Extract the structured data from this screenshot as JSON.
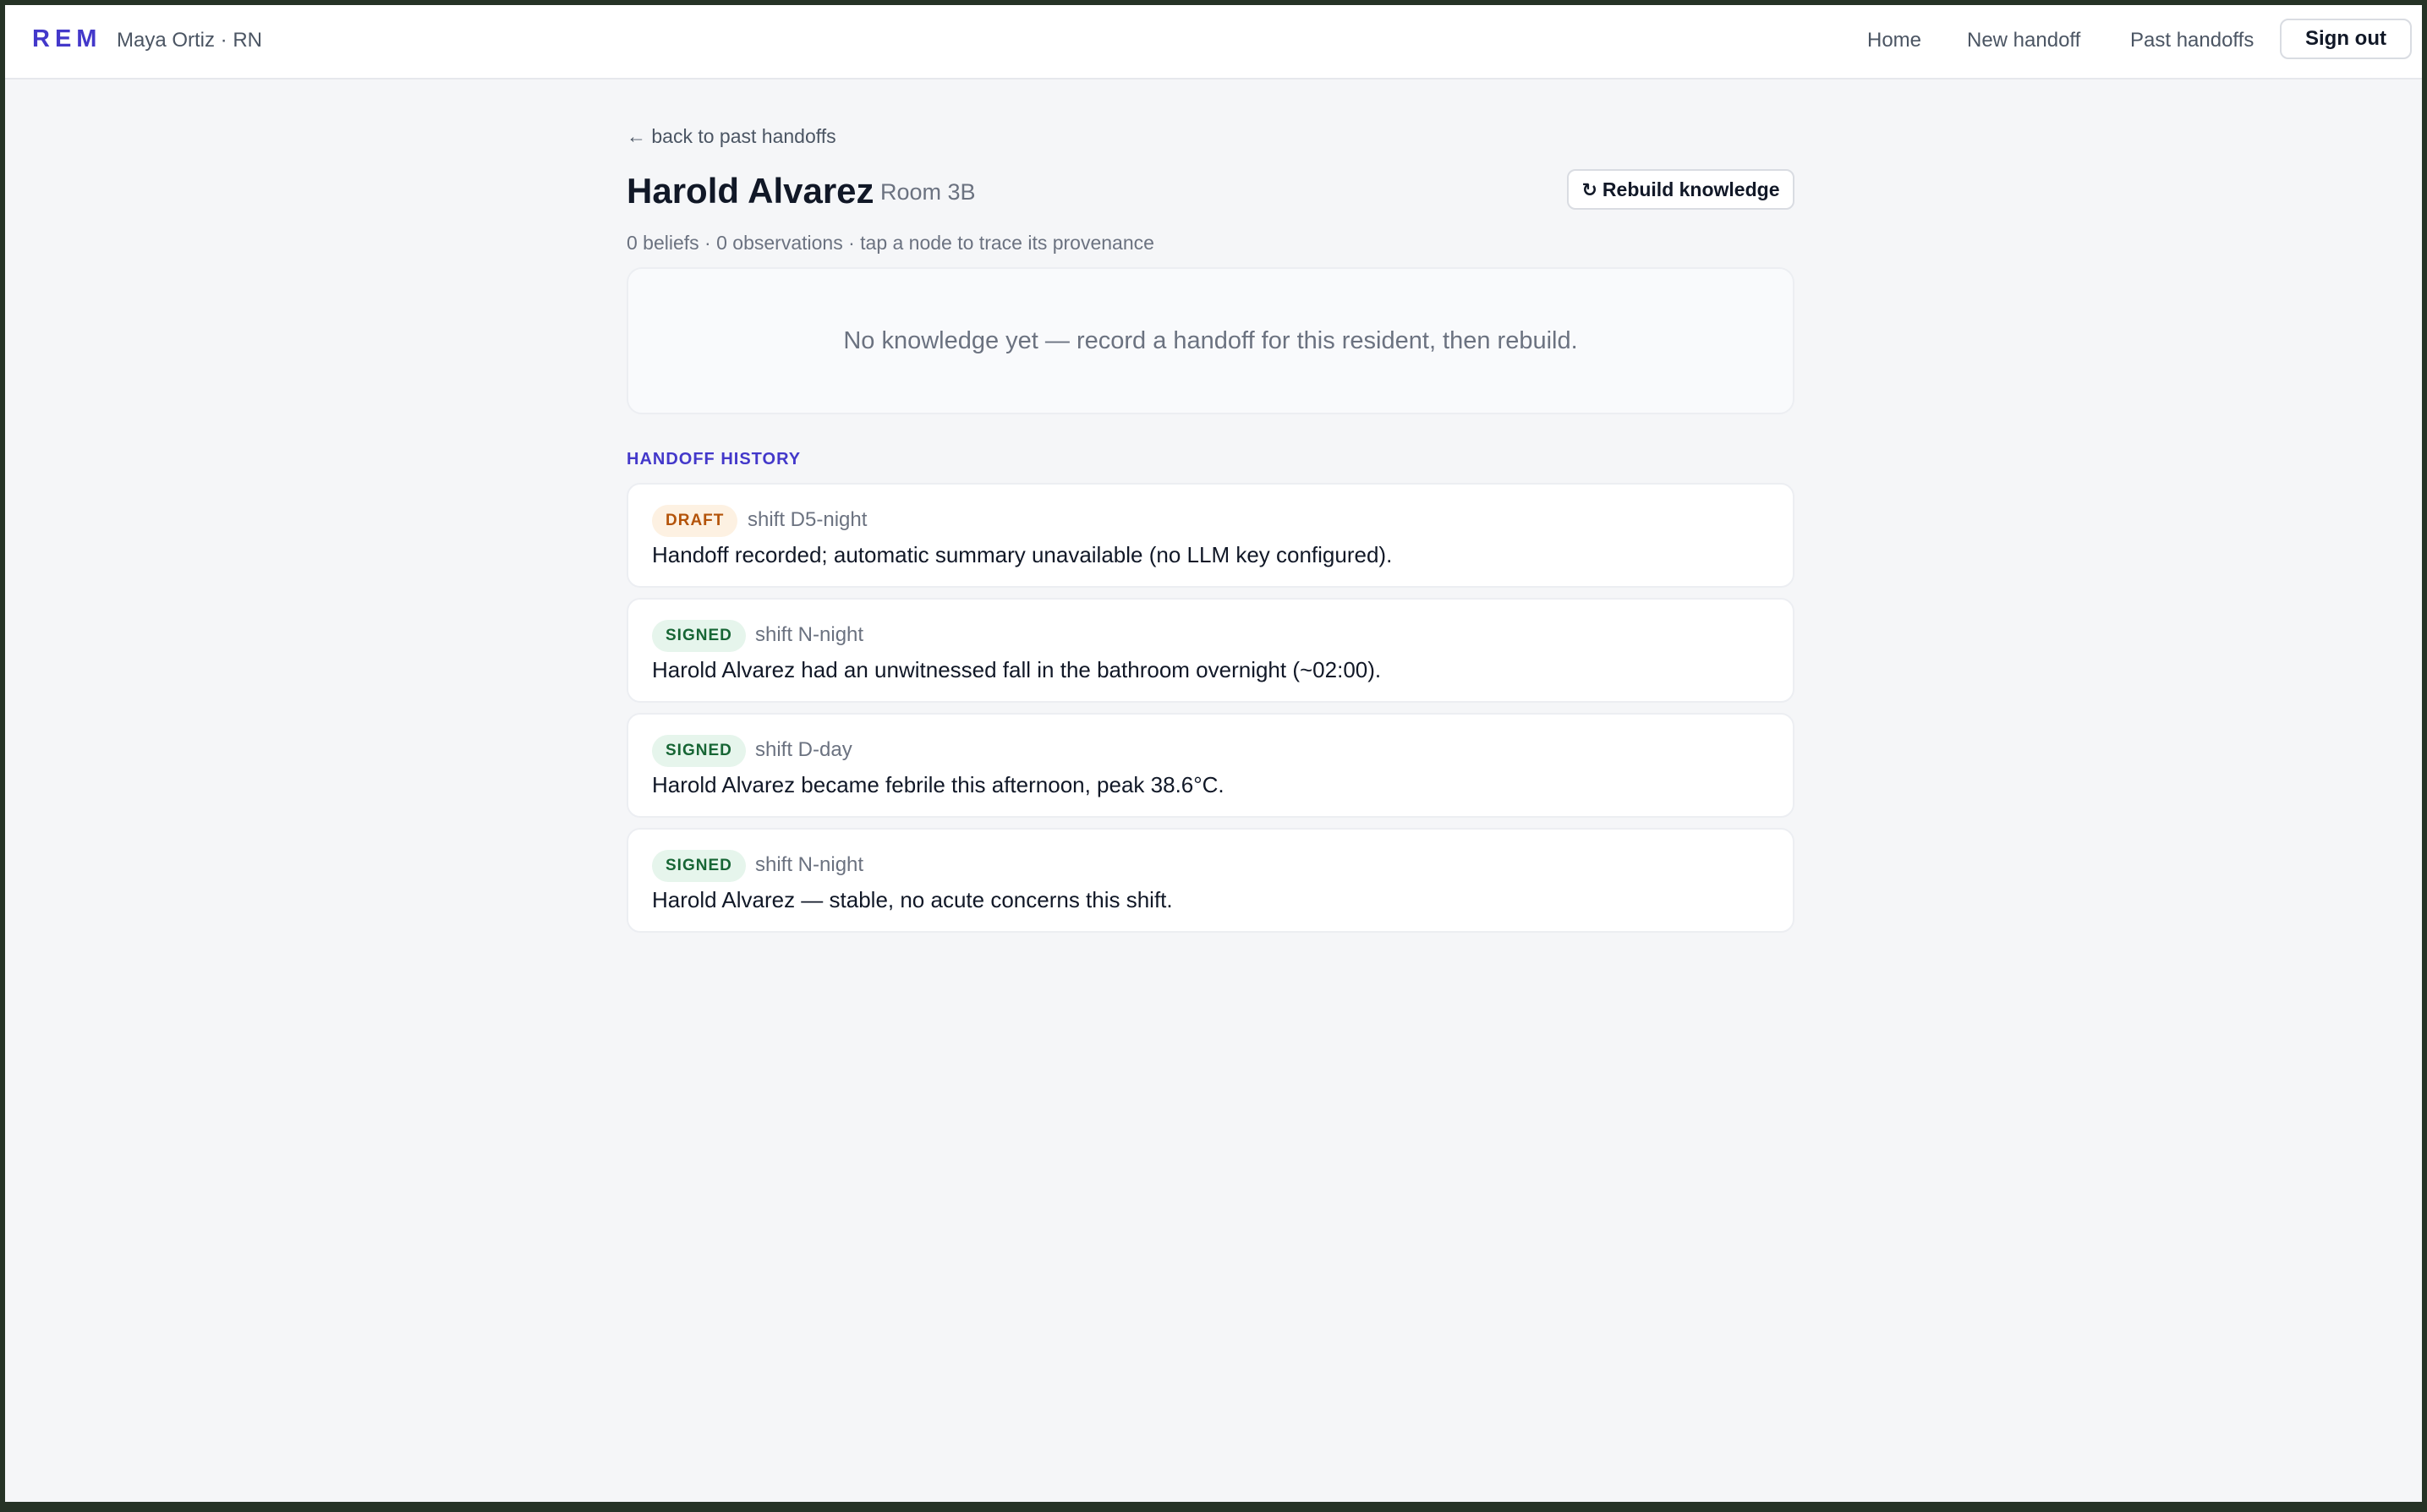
{
  "header": {
    "brand": "REM",
    "user": "Maya Ortiz · RN",
    "nav": {
      "home": "Home",
      "new_handoff": "New handoff",
      "past_handoffs": "Past handoffs",
      "sign_out": "Sign out"
    }
  },
  "main": {
    "back_link": "← back to past handoffs",
    "patient_name": "Harold Alvarez",
    "room": "Room 3B",
    "rebuild_icon": "↻",
    "rebuild_label": "Rebuild knowledge",
    "stats": "0 beliefs · 0 observations · tap a node to trace its provenance",
    "empty_message": "No knowledge yet — record a handoff for this resident, then rebuild.",
    "history_title": "HANDOFF HISTORY",
    "history": [
      {
        "status": "DRAFT",
        "shift": "shift D5-night",
        "summary": "Handoff recorded; automatic summary unavailable (no LLM key configured)."
      },
      {
        "status": "SIGNED",
        "shift": "shift N-night",
        "summary": "Harold Alvarez had an unwitnessed fall in the bathroom overnight (~02:00)."
      },
      {
        "status": "SIGNED",
        "shift": "shift D-day",
        "summary": "Harold Alvarez became febrile this afternoon, peak 38.6°C."
      },
      {
        "status": "SIGNED",
        "shift": "shift N-night",
        "summary": "Harold Alvarez — stable, no acute concerns this shift."
      }
    ]
  },
  "colors": {
    "accent": "#4338ca",
    "draft_bg": "#fdf1e2",
    "draft_text": "#b45309",
    "signed_bg": "#e6f5ec",
    "signed_text": "#166534"
  }
}
